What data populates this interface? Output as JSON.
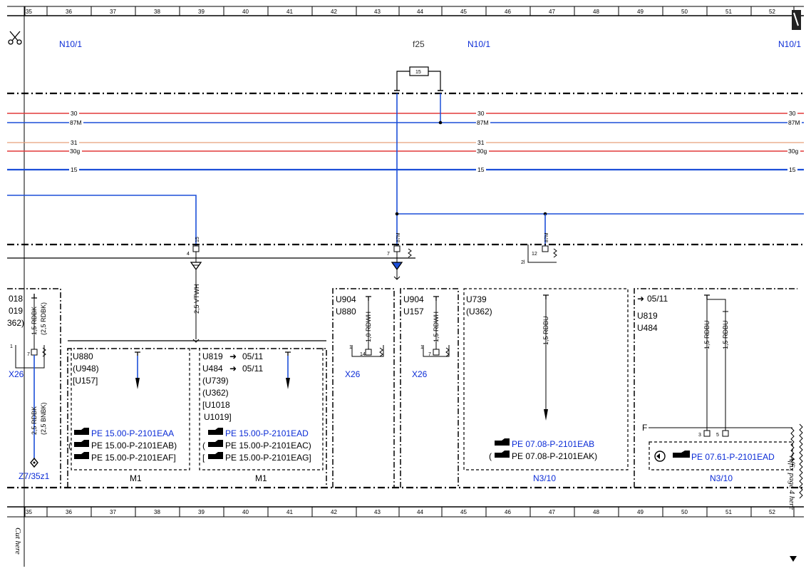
{
  "ruler": {
    "top": [
      "35",
      "36",
      "37",
      "38",
      "39",
      "40",
      "41",
      "42",
      "43",
      "44",
      "45",
      "46",
      "47",
      "48",
      "49",
      "50",
      "51",
      "52"
    ],
    "bottom": [
      "35",
      "36",
      "37",
      "38",
      "39",
      "40",
      "41",
      "42",
      "43",
      "44",
      "45",
      "46",
      "47",
      "48",
      "49",
      "50",
      "51",
      "52"
    ]
  },
  "header": {
    "left_ref": "N10/1",
    "mid_ref": "N10/1",
    "right_ref": "N10/1",
    "fuse_label": "f25",
    "fuse_value": "15"
  },
  "buses": {
    "b30_label": "30",
    "b87m_label": "87M",
    "b31_label": "31",
    "b30g_label": "30g",
    "b15_label": "15"
  },
  "connectors": {
    "pin4": "4",
    "pin7": "7",
    "pin2l": "2l",
    "pin12": "12",
    "wire_15": "15",
    "wire_87m_a": "87M",
    "wire_87m_b": "87M",
    "vtwh": "2,5 VTWH"
  },
  "blocks": {
    "left": {
      "codes": [
        "018",
        "019",
        "362)"
      ],
      "wire1": "1,5 RDBK",
      "wire1b": "(2,5 RDBK)",
      "pin1": "1",
      "pin7": "7",
      "conn": "X26",
      "wire2": "2,5 RDBK",
      "wire2b": "(2,5 BNBK)",
      "ground": "Z7/35z1"
    },
    "m1a": {
      "codes": [
        "U880",
        "(U948)",
        "[U157]"
      ],
      "refs": [
        "PE 15.00-P-2101EAA",
        "PE 15.00-P-2101EAB)",
        "PE 15.00-P-2101EAF]"
      ],
      "ref_open": [
        "",
        "(",
        ""
      ],
      "name": "M1"
    },
    "m1b": {
      "codes": [
        "U819",
        "U484",
        "(U739)",
        "(U362)",
        "[U1018",
        "U1019]"
      ],
      "arrows": [
        "05/11",
        "05/11"
      ],
      "refs": [
        "PE 15.00-P-2101EAD",
        "PE 15.00-P-2101EAC)",
        "PE 15.00-P-2101EAG]"
      ],
      "ref_open": [
        "",
        "(",
        "["
      ],
      "name": "M1"
    },
    "x26a": {
      "codes": [
        "U904",
        "U880"
      ],
      "wire": "1,0 RDWH",
      "pin1": "1",
      "pin14": "14",
      "conn": "X26"
    },
    "x26b": {
      "codes": [
        "U904",
        "U157"
      ],
      "wire": "1,5 RDWH",
      "pin1": "1",
      "pin7": "7",
      "conn": "X26"
    },
    "n310a": {
      "codes": [
        "U739",
        "(U362)"
      ],
      "wire": "1,5 RDBU",
      "refs": [
        "PE 07.08-P-2101EAB",
        "PE 07.08-P-2101EAK)"
      ],
      "ref_open": [
        "",
        "("
      ],
      "name": "N3/10"
    },
    "n310b": {
      "arrow": "05/11",
      "codes": [
        "U819",
        "U484"
      ],
      "wire1": "1,5 RDBU",
      "wire2": "1,5 RDBU",
      "pinF": "F",
      "pin3": "3",
      "pin5": "5",
      "ref": "PE 07.61-P-2101EAD",
      "name": "N3/10"
    }
  },
  "margin": {
    "cut": "Cut here",
    "affix": "Affix page 4 here"
  },
  "colors": {
    "blue_wire": "#1c4fd8",
    "red_wire": "#e23a3a",
    "ref_blue": "#0a2bd6"
  }
}
